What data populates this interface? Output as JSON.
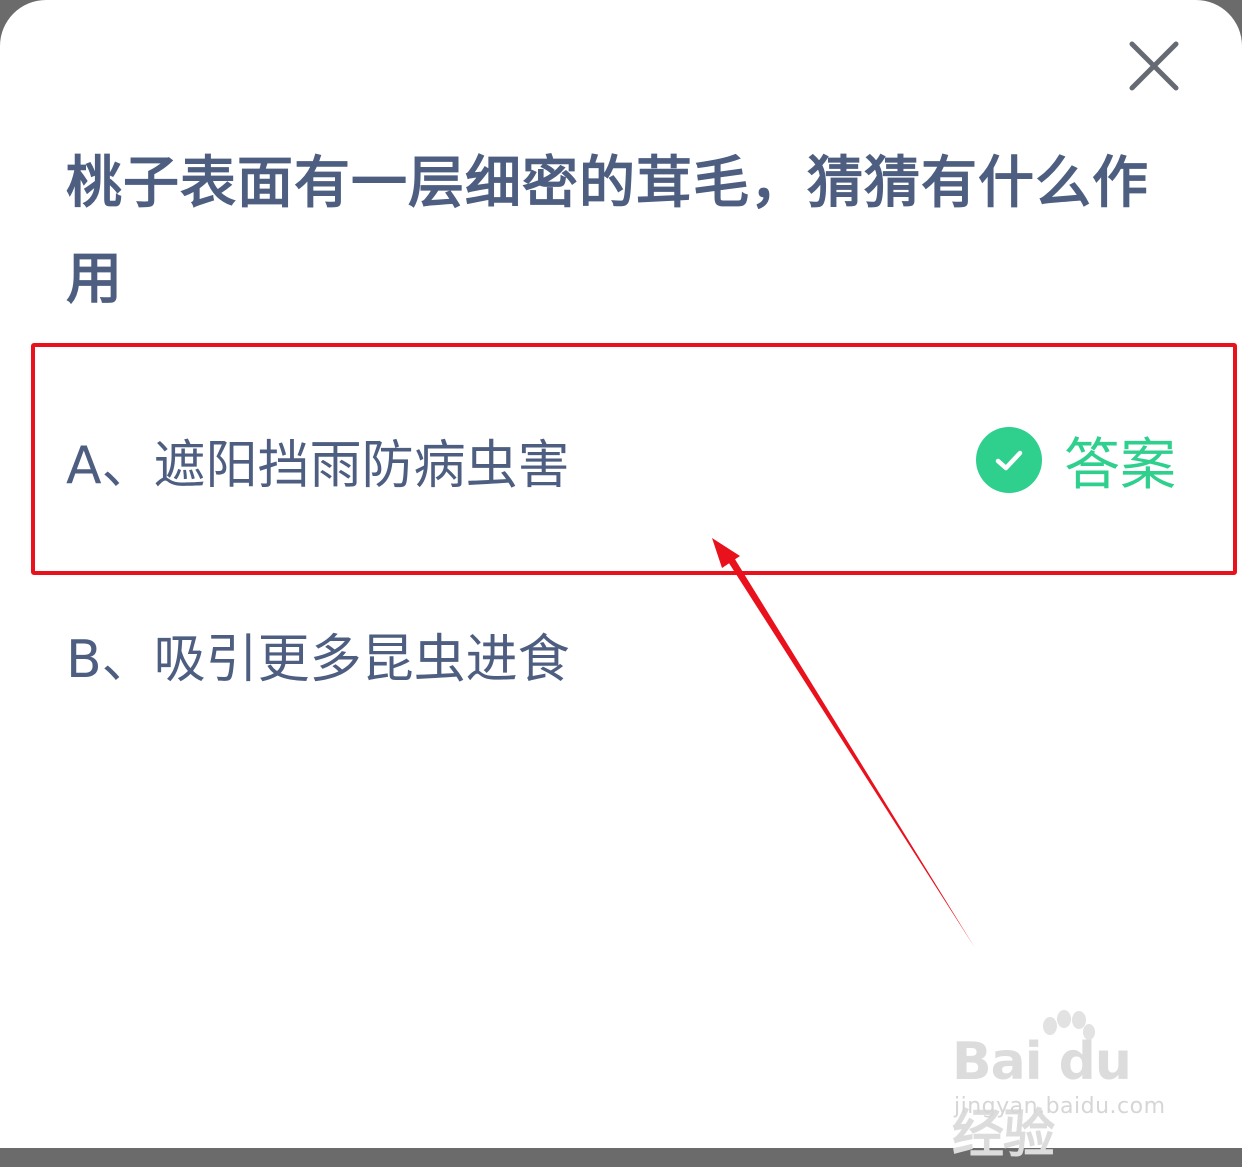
{
  "dialog": {
    "close_icon": "close-icon",
    "question": "桃子表面有一层细密的茸毛，猜猜有什么作用"
  },
  "options": [
    {
      "label": "A、遮阳挡雨防病虫害",
      "is_answer": true,
      "answer_tag": "答案",
      "answer_icon": "check-circle-icon"
    },
    {
      "label": "B、吸引更多昆虫进食",
      "is_answer": false
    }
  ],
  "annotation": {
    "box_color": "#e8111c",
    "arrow_color": "#e8111c"
  },
  "watermark": {
    "logo_text": "Bai du 经验",
    "url": "jingyan.baidu.com"
  },
  "colors": {
    "text": "#4d5e80",
    "accent": "#2fcf8d",
    "background": "#ffffff"
  }
}
